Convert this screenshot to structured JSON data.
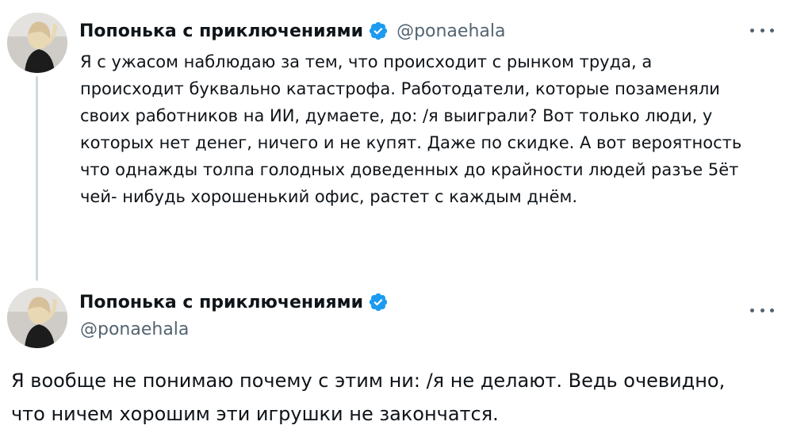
{
  "tweets": [
    {
      "author": {
        "display_name": "Попонька с приключениями",
        "handle": "@ponaehala",
        "verified": true,
        "avatar_icon": "profile-photo"
      },
      "text": "Я с ужасом наблюдаю за тем, что происходит с рынком труда, а\nпроисходит буквально катастрофа. Работодатели, которые позаменяли\nсвоих работников на ИИ, думаете, до: /я выиграли?  Вот только люди, у\nкоторых нет денег, ничего и не купят. Даже по скидке.  А вот вероятность\nчто однажды толпа голодных доведенных до крайности людей разъе 5ёт\nчей- нибудь хорошенький офис, растет с каждым днём."
    },
    {
      "author": {
        "display_name": "Попонька с приключениями",
        "handle": "@ponaehala",
        "verified": true,
        "avatar_icon": "profile-photo"
      },
      "text": "Я вообще не понимаю почему с этим ни: /я не делают. Ведь очевидно,\nчто ничем хорошим эти игрушки не закончатся."
    }
  ],
  "colors": {
    "text_primary": "#0f1419",
    "text_secondary": "#536471",
    "verified_blue": "#1d9bf0",
    "thread_line": "#cfd9de"
  },
  "icons": {
    "verified": "verified-badge-icon",
    "more": "more-options-icon"
  }
}
